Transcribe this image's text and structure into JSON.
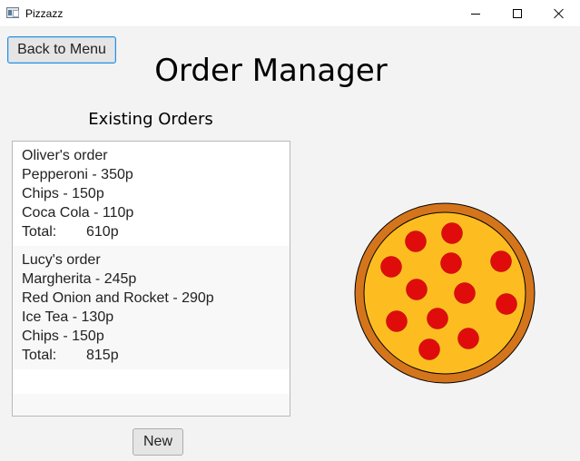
{
  "window": {
    "title": "Pizzazz",
    "icon": "app-window-icon"
  },
  "header": {
    "back_label": "Back to Menu",
    "title": "Order Manager"
  },
  "orders_section": {
    "title": "Existing Orders",
    "orders": [
      {
        "name": "Oliver's order",
        "items": [
          "Pepperoni - 350p",
          "Chips - 150p",
          "Coca Cola - 110p"
        ],
        "total_label": "Total:",
        "total_value": "610p"
      },
      {
        "name": "Lucy's order",
        "items": [
          "Margherita - 245p",
          "Red Onion and Rocket - 290p",
          "Ice Tea - 130p",
          "Chips - 150p"
        ],
        "total_label": "Total:",
        "total_value": "815p"
      }
    ]
  },
  "footer": {
    "new_label": "New"
  },
  "colors": {
    "crust": "#d4751c",
    "cheese": "#fdbd21",
    "pepperoni": "#e00c0c",
    "accent_border": "#2f8ed8"
  }
}
